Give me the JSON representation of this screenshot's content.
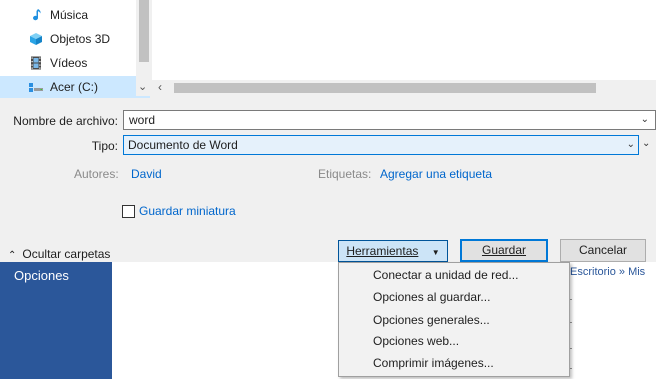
{
  "nav": {
    "items": [
      {
        "label": "Música",
        "icon": "music-note-icon"
      },
      {
        "label": "Objetos 3D",
        "icon": "cube-icon"
      },
      {
        "label": "Vídeos",
        "icon": "film-icon"
      },
      {
        "label": "Acer (C:)",
        "icon": "drive-icon"
      }
    ]
  },
  "form": {
    "filename_label": "Nombre de archivo:",
    "filename_value": "word",
    "type_label": "Tipo:",
    "type_value": "Documento de Word",
    "authors_label": "Autores:",
    "authors_value": "David",
    "tags_label": "Etiquetas:",
    "tags_value": "Agregar una etiqueta",
    "thumbnail_label": "Guardar miniatura",
    "thumbnail_checked": false
  },
  "footer": {
    "hide_folders": "Ocultar carpetas",
    "tools": "Herramientas",
    "save": "Guardar",
    "cancel": "Cancelar"
  },
  "tools_menu": {
    "items": [
      "Conectar a unidad de red...",
      "Opciones al guardar...",
      "Opciones generales...",
      "Opciones web...",
      "Comprimir imágenes..."
    ]
  },
  "background": {
    "left_label": "Opciones",
    "right_text": "Escritorio » Mis"
  },
  "colors": {
    "accent": "#0078d7",
    "link": "#0066cc",
    "word_blue": "#2b579a",
    "selection": "#cce8ff"
  }
}
